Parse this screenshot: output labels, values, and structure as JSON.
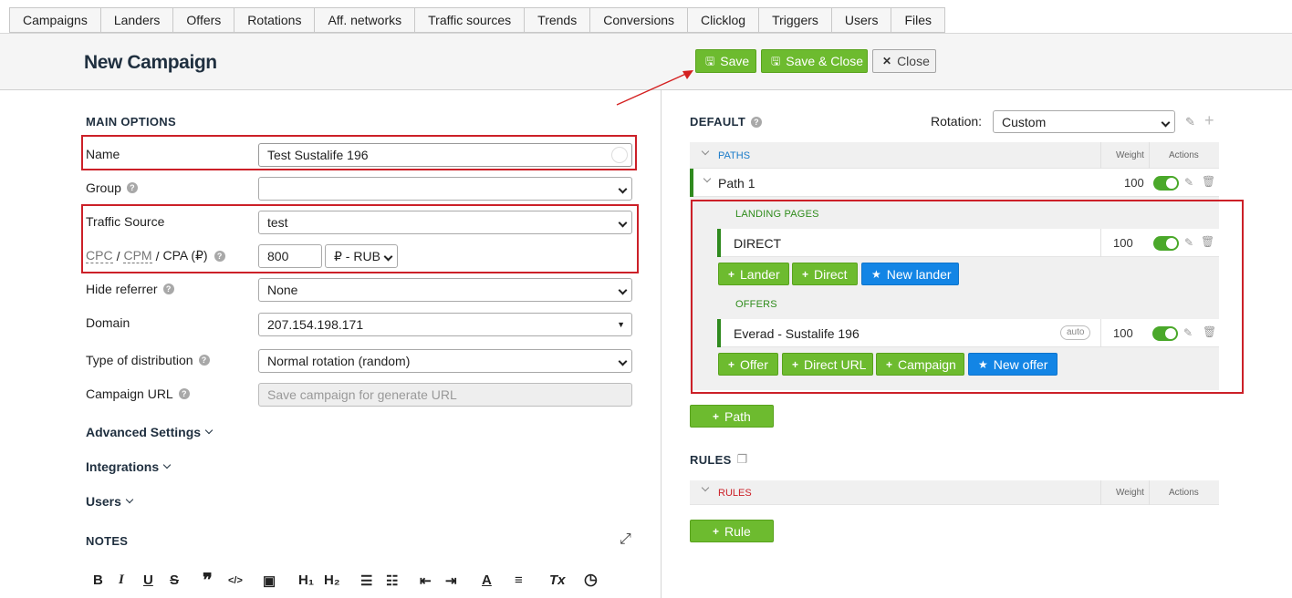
{
  "nav": {
    "tabs": [
      "Campaigns",
      "Landers",
      "Offers",
      "Rotations",
      "Aff. networks",
      "Traffic sources",
      "Trends",
      "Conversions",
      "Clicklog",
      "Triggers",
      "Users",
      "Files"
    ]
  },
  "header": {
    "title": "New Campaign",
    "save": "Save",
    "save_close": "Save & Close",
    "close": "Close"
  },
  "main": {
    "section_title": "MAIN OPTIONS",
    "name_label": "Name",
    "name_value": "Test Sustalife 196",
    "group_label": "Group",
    "group_value": "",
    "traffic_source_label": "Traffic Source",
    "traffic_source_value": "test",
    "cost": {
      "cpc": "CPC",
      "sep1": "/",
      "cpm": "CPM",
      "sep2": "/",
      "cpa": "CPA (₽)",
      "value": "800",
      "currency": "₽ - RUB"
    },
    "hide_referrer_label": "Hide referrer",
    "hide_referrer_value": "None",
    "domain_label": "Domain",
    "domain_value": "207.154.198.171",
    "distribution_label": "Type of distribution",
    "distribution_value": "Normal rotation (random)",
    "url_label": "Campaign URL",
    "url_placeholder": "Save campaign for generate URL",
    "advanced": "Advanced Settings",
    "integrations": "Integrations",
    "users": "Users",
    "notes": "NOTES"
  },
  "toolbar": [
    "B",
    "I",
    "U",
    "S",
    "❞",
    "</>",
    "▣",
    "H₁",
    "H₂",
    "☰",
    "☷",
    "⇤",
    "⇥",
    "A",
    "≡",
    "Tx",
    "◷"
  ],
  "default_panel": {
    "title": "DEFAULT",
    "rotation_label": "Rotation:",
    "rotation_value": "Custom",
    "paths_header": "PATHS",
    "weight_header": "Weight",
    "actions_header": "Actions",
    "path": {
      "name": "Path 1",
      "weight": "100"
    },
    "landing_pages_header": "LANDING PAGES",
    "lander": {
      "name": "DIRECT",
      "weight": "100"
    },
    "lander_buttons": {
      "lander": "Lander",
      "direct": "Direct",
      "new_lander": "New lander"
    },
    "offers_header": "OFFERS",
    "offer": {
      "name": "Everad - Sustalife 196",
      "badge": "auto",
      "weight": "100"
    },
    "offer_buttons": {
      "offer": "Offer",
      "direct_url": "Direct URL",
      "campaign": "Campaign",
      "new_offer": "New offer"
    },
    "path_button": "Path"
  },
  "rules_panel": {
    "title": "RULES",
    "rules_header": "RULES",
    "weight_header": "Weight",
    "actions_header": "Actions",
    "rule_button": "Rule"
  },
  "colors": {
    "green": "#6dbb2f",
    "blue": "#1385e5",
    "highlight_red": "#cc2028",
    "title": "#1f2f3f"
  }
}
